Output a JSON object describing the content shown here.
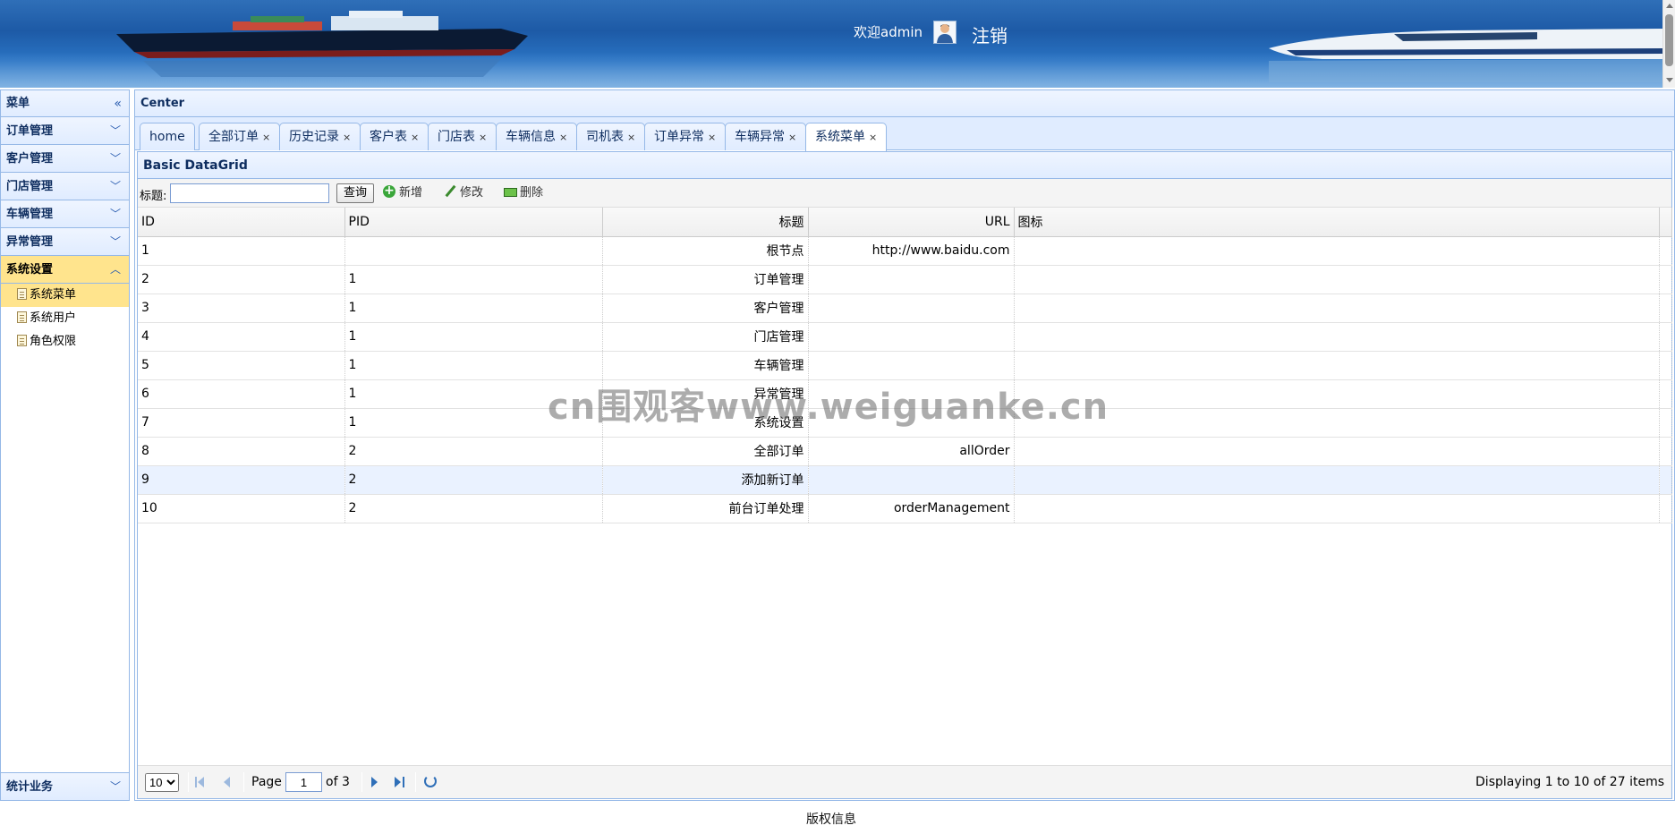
{
  "header": {
    "welcome": "欢迎admin",
    "logout": "注销"
  },
  "west": {
    "title": "菜单",
    "collapse_icon": "«",
    "sections": [
      {
        "label": "订单管理"
      },
      {
        "label": "客户管理"
      },
      {
        "label": "门店管理"
      },
      {
        "label": "车辆管理"
      },
      {
        "label": "异常管理"
      },
      {
        "label": "系统设置"
      }
    ],
    "system_items": [
      {
        "label": "系统菜单"
      },
      {
        "label": "系统用户"
      },
      {
        "label": "角色权限"
      }
    ],
    "bottom_section": "统计业务"
  },
  "center": {
    "title": "Center",
    "tabs": [
      {
        "label": "home"
      },
      {
        "label": "全部订单"
      },
      {
        "label": "历史记录"
      },
      {
        "label": "客户表"
      },
      {
        "label": "门店表"
      },
      {
        "label": "车辆信息"
      },
      {
        "label": "司机表"
      },
      {
        "label": "订单异常"
      },
      {
        "label": "车辆异常"
      },
      {
        "label": "系统菜单"
      }
    ],
    "close": "×"
  },
  "grid": {
    "title": "Basic DataGrid",
    "search_label": "标题:",
    "search_value": "",
    "query_button": "查询",
    "add_button": "新增",
    "edit_button": "修改",
    "delete_button": "删除",
    "columns": [
      "ID",
      "PID",
      "标题",
      "URL",
      "图标"
    ],
    "rows": [
      {
        "id": "1",
        "pid": "",
        "title": "根节点",
        "url": "http://www.baidu.com",
        "icon": ""
      },
      {
        "id": "2",
        "pid": "1",
        "title": "订单管理",
        "url": "",
        "icon": ""
      },
      {
        "id": "3",
        "pid": "1",
        "title": "客户管理",
        "url": "",
        "icon": ""
      },
      {
        "id": "4",
        "pid": "1",
        "title": "门店管理",
        "url": "",
        "icon": ""
      },
      {
        "id": "5",
        "pid": "1",
        "title": "车辆管理",
        "url": "",
        "icon": ""
      },
      {
        "id": "6",
        "pid": "1",
        "title": "异常管理",
        "url": "",
        "icon": ""
      },
      {
        "id": "7",
        "pid": "1",
        "title": "系统设置",
        "url": "",
        "icon": ""
      },
      {
        "id": "8",
        "pid": "2",
        "title": "全部订单",
        "url": "allOrder",
        "icon": ""
      },
      {
        "id": "9",
        "pid": "2",
        "title": "添加新订单",
        "url": "",
        "icon": ""
      },
      {
        "id": "10",
        "pid": "2",
        "title": "前台订单处理",
        "url": "orderManagement",
        "icon": ""
      }
    ]
  },
  "pager": {
    "page_size": "10",
    "page_label": "Page",
    "page_value": "1",
    "of_label": "of 3",
    "display": "Displaying 1 to 10 of 27 items"
  },
  "footer": {
    "text": "版权信息"
  },
  "watermark": "cn围观客www.weiguanke.cn"
}
